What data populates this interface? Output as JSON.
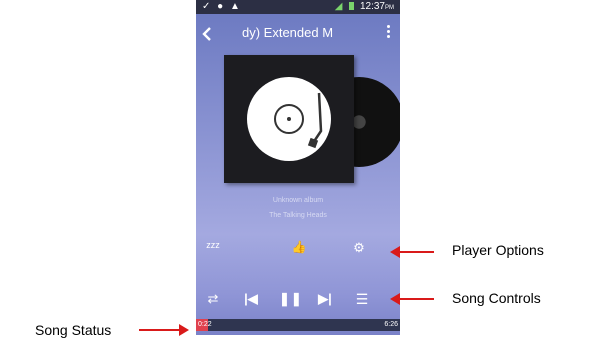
{
  "status_bar": {
    "icons_left": "✓ ● ▲",
    "time": "12:37",
    "ampm": "PM"
  },
  "header": {
    "back_icon": "back-arrow-icon",
    "title": "dy) Extended M",
    "menu_icon": "overflow-menu-icon"
  },
  "album_art": {
    "icon": "turntable-icon"
  },
  "track_info": {
    "album": "Unknown album",
    "artist": "The Talking Heads"
  },
  "options": [
    {
      "name": "sleep-timer",
      "icon": "sleep-timer-icon",
      "glyph": "zzz"
    },
    {
      "name": "like",
      "icon": "thumbs-up-icon",
      "glyph": "👍"
    },
    {
      "name": "settings",
      "icon": "gear-icon",
      "glyph": "⚙"
    }
  ],
  "controls": {
    "repeat": "⇄",
    "prev": "|◀",
    "pause": "❚❚",
    "next": "▶|",
    "playlist": "☰"
  },
  "progress": {
    "elapsed": "0:22",
    "duration": "6:26",
    "fraction": 0.057
  },
  "annotations": {
    "player_options": "Player Options",
    "song_controls": "Song Controls",
    "song_status": "Song Status"
  },
  "colors": {
    "accent": "#e0414e",
    "arrow": "#d91a1a"
  }
}
